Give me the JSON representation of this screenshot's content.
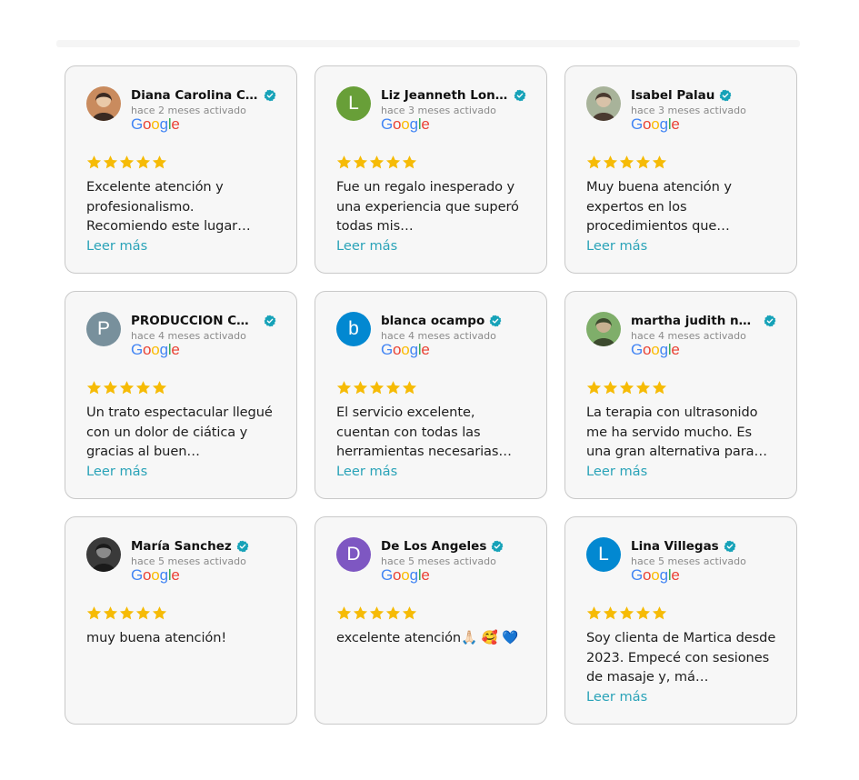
{
  "colors": {
    "star": "#f6bb06",
    "verified": "#16a2b8",
    "link": "#2aa3b8",
    "google": [
      "#4285F4",
      "#EA4335",
      "#FBBC05",
      "#4285F4",
      "#34A853",
      "#EA4335"
    ]
  },
  "brand": "Google",
  "read_more_label": "Leer más",
  "reviews": [
    {
      "name": "Diana Carolina Ca...",
      "time": "hace 2 meses activado",
      "rating": 5,
      "text": "Excelente atención y profesionalismo. Recomiendo este lugar…",
      "avatar": {
        "type": "photo",
        "icon": "user-photo"
      }
    },
    {
      "name": "Liz Jeanneth Lond...",
      "time": "hace 3 meses activado",
      "rating": 5,
      "text": "Fue un regalo inesperado y una experiencia que superó todas mis…",
      "avatar": {
        "type": "initial",
        "letter": "L",
        "color": "#689f38"
      }
    },
    {
      "name": "Isabel Palau",
      "time": "hace 3 meses activado",
      "rating": 5,
      "text": "Muy buena atención y expertos en los procedimientos que…",
      "avatar": {
        "type": "photo",
        "icon": "user-photo"
      }
    },
    {
      "name": "PRODUCCION COL...",
      "time": "hace 4 meses activado",
      "rating": 5,
      "text": "Un trato espectacular llegué con un dolor de ciática y gracias al buen…",
      "avatar": {
        "type": "initial",
        "letter": "P",
        "color": "#78909c"
      }
    },
    {
      "name": "blanca ocampo",
      "time": "hace 4 meses activado",
      "rating": 5,
      "text": "El servicio excelente, cuentan con todas las herramientas necesarias…",
      "avatar": {
        "type": "initial",
        "letter": "b",
        "color": "#0288d1"
      }
    },
    {
      "name": "martha judith nuñ...",
      "time": "hace 4 meses activado",
      "rating": 5,
      "text": "La terapia con ultrasonido me ha servido mucho. Es una gran alternativa para…",
      "avatar": {
        "type": "photo",
        "icon": "user-photo"
      }
    },
    {
      "name": "María Sanchez",
      "time": "hace 5 meses activado",
      "rating": 5,
      "text": "muy buena atención!",
      "avatar": {
        "type": "photo",
        "icon": "user-photo"
      }
    },
    {
      "name": "De Los Angeles",
      "time": "hace 5 meses activado",
      "rating": 5,
      "text": "excelente atención🙏🏻 🥰 💙",
      "avatar": {
        "type": "initial",
        "letter": "D",
        "color": "#7e57c2"
      }
    },
    {
      "name": "Lina Villegas",
      "time": "hace 5 meses activado",
      "rating": 5,
      "text": "Soy clienta de Martica desde 2023. Empecé con sesiones de masaje y, má…",
      "avatar": {
        "type": "initial",
        "letter": "L",
        "color": "#0288d1"
      }
    }
  ],
  "read_more_visible": [
    true,
    true,
    true,
    true,
    true,
    true,
    false,
    false,
    true
  ]
}
